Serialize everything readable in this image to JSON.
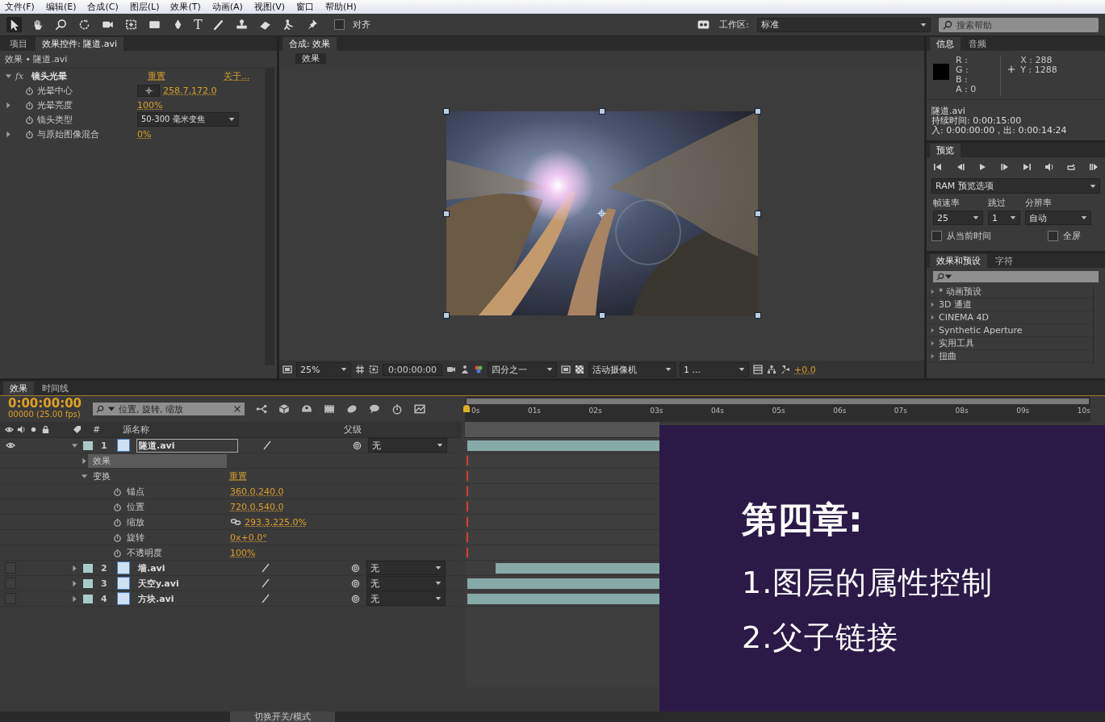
{
  "menu": [
    "文件(F)",
    "编辑(E)",
    "合成(C)",
    "图层(L)",
    "效果(T)",
    "动画(A)",
    "视图(V)",
    "窗口",
    "帮助(H)"
  ],
  "toolbar": {
    "type_tool": "T",
    "snap": {
      "label": "对齐",
      "checked": false
    },
    "workspace": {
      "label": "工作区:",
      "value": "标准"
    },
    "search": {
      "placeholder": "搜索帮助"
    }
  },
  "effect_panel": {
    "tabs": [
      {
        "label": "项目",
        "selected": false
      },
      {
        "label": "效果控件: 隧道.avi",
        "selected": true
      }
    ],
    "breadcrumb": "效果 • 隧道.avi",
    "effect": {
      "badge": "fx",
      "name": "镜头光晕",
      "reset": "重置",
      "about": "关于...",
      "expanded": true,
      "props": [
        {
          "kind": "point",
          "name": "光晕中心",
          "value": "258.7,172.0"
        },
        {
          "kind": "toggle",
          "name": "光晕亮度",
          "value": "100%"
        },
        {
          "kind": "dropdown",
          "name": "镜头类型",
          "value": "50-300 毫米变焦"
        },
        {
          "kind": "toggle",
          "name": "与原始图像混合",
          "value": "0%"
        }
      ]
    }
  },
  "composition": {
    "tab": "合成: 效果",
    "subtab": "效果",
    "footer": {
      "zoom": "25%",
      "time": "0:00:00:00",
      "resolution": "四分之一",
      "camera": "活动摄像机",
      "views": "1 ...",
      "exposure": "+0.0"
    }
  },
  "info": {
    "tabs": [
      {
        "label": "信息",
        "selected": true
      },
      {
        "label": "音频",
        "selected": false
      }
    ],
    "channels": [
      "R :",
      "G :",
      "B :",
      "A : 0"
    ],
    "x": "X : 288",
    "y": "Y : 1288",
    "file": "隧道.avi",
    "duration": "持续时间: 0:00:15:00",
    "inout": "入: 0:00:00:00，出: 0:00:14:24"
  },
  "preview": {
    "tab": "预览",
    "ram": "RAM 预览选项",
    "fields": [
      {
        "label": "帧速率",
        "value": "25"
      },
      {
        "label": "跳过",
        "value": "1"
      },
      {
        "label": "分辨率",
        "value": "自动"
      }
    ],
    "checks": [
      {
        "label": "从当前时间",
        "checked": false
      },
      {
        "label": "全屏",
        "checked": false
      }
    ]
  },
  "presets": {
    "tabs": [
      {
        "label": "效果和预设",
        "selected": true
      },
      {
        "label": "字符",
        "selected": false
      }
    ],
    "items": [
      "* 动画预设",
      "3D 通道",
      "CINEMA 4D",
      "Synthetic Aperture",
      "实用工具",
      "扭曲"
    ]
  },
  "timeline": {
    "tabs": [
      {
        "label": "效果",
        "selected": true
      },
      {
        "label": "时间线",
        "selected": false
      }
    ],
    "timecode": "0:00:00:00",
    "fps": "00000 (25.00 fps)",
    "search": "位置, 旋转, 缩放",
    "columns": [
      "#",
      "源名称",
      "父级"
    ],
    "ticks": [
      "0s",
      "01s",
      "02s",
      "03s",
      "04s",
      "05s",
      "06s",
      "07s",
      "08s",
      "09s",
      "10s"
    ],
    "layers": [
      {
        "number": "1",
        "name": "隧道.avi",
        "visible": true,
        "expanded": true,
        "parent": "无",
        "effects": {
          "label": "效果",
          "expanded": false,
          "selected": true
        },
        "transform": {
          "label": "变换",
          "expanded": true,
          "reset": "重置",
          "props": [
            {
              "name": "锚点",
              "value": "360.0,240.0",
              "linked": false
            },
            {
              "name": "位置",
              "value": "720.0,540.0",
              "linked": false
            },
            {
              "name": "缩放",
              "value": "293.3,225.0%",
              "linked": true
            },
            {
              "name": "旋转",
              "value": "0x+0.0°",
              "linked": false
            },
            {
              "name": "不透明度",
              "value": "100%",
              "linked": false
            }
          ]
        }
      },
      {
        "number": "2",
        "name": "墙.avi",
        "visible": false,
        "expanded": false,
        "parent": "无"
      },
      {
        "number": "3",
        "name": "天空y.avi",
        "visible": false,
        "expanded": false,
        "parent": "无"
      },
      {
        "number": "4",
        "name": "方块.avi",
        "visible": false,
        "expanded": false,
        "parent": "无"
      }
    ],
    "footer": "切换开关/模式"
  },
  "overlay": {
    "title": "第四章:",
    "items": [
      "1.图层的属性控制",
      "2.父子链接"
    ]
  }
}
